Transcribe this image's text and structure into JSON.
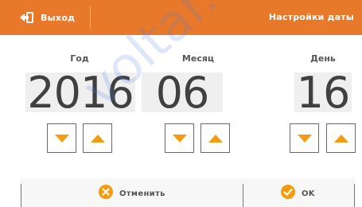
{
  "header": {
    "exit_label": "Выход",
    "title": "Настройки даты"
  },
  "columns": [
    {
      "label": "Год",
      "value": "2016"
    },
    {
      "label": "Месяц",
      "value": "06"
    },
    {
      "label": "День",
      "value": "16"
    }
  ],
  "footer": {
    "cancel_label": "Отменить",
    "ok_label": "OK"
  },
  "watermark": "voltar.com",
  "colors": {
    "accent": "#e8782a",
    "arrow": "#f39c12",
    "text": "#404040"
  }
}
